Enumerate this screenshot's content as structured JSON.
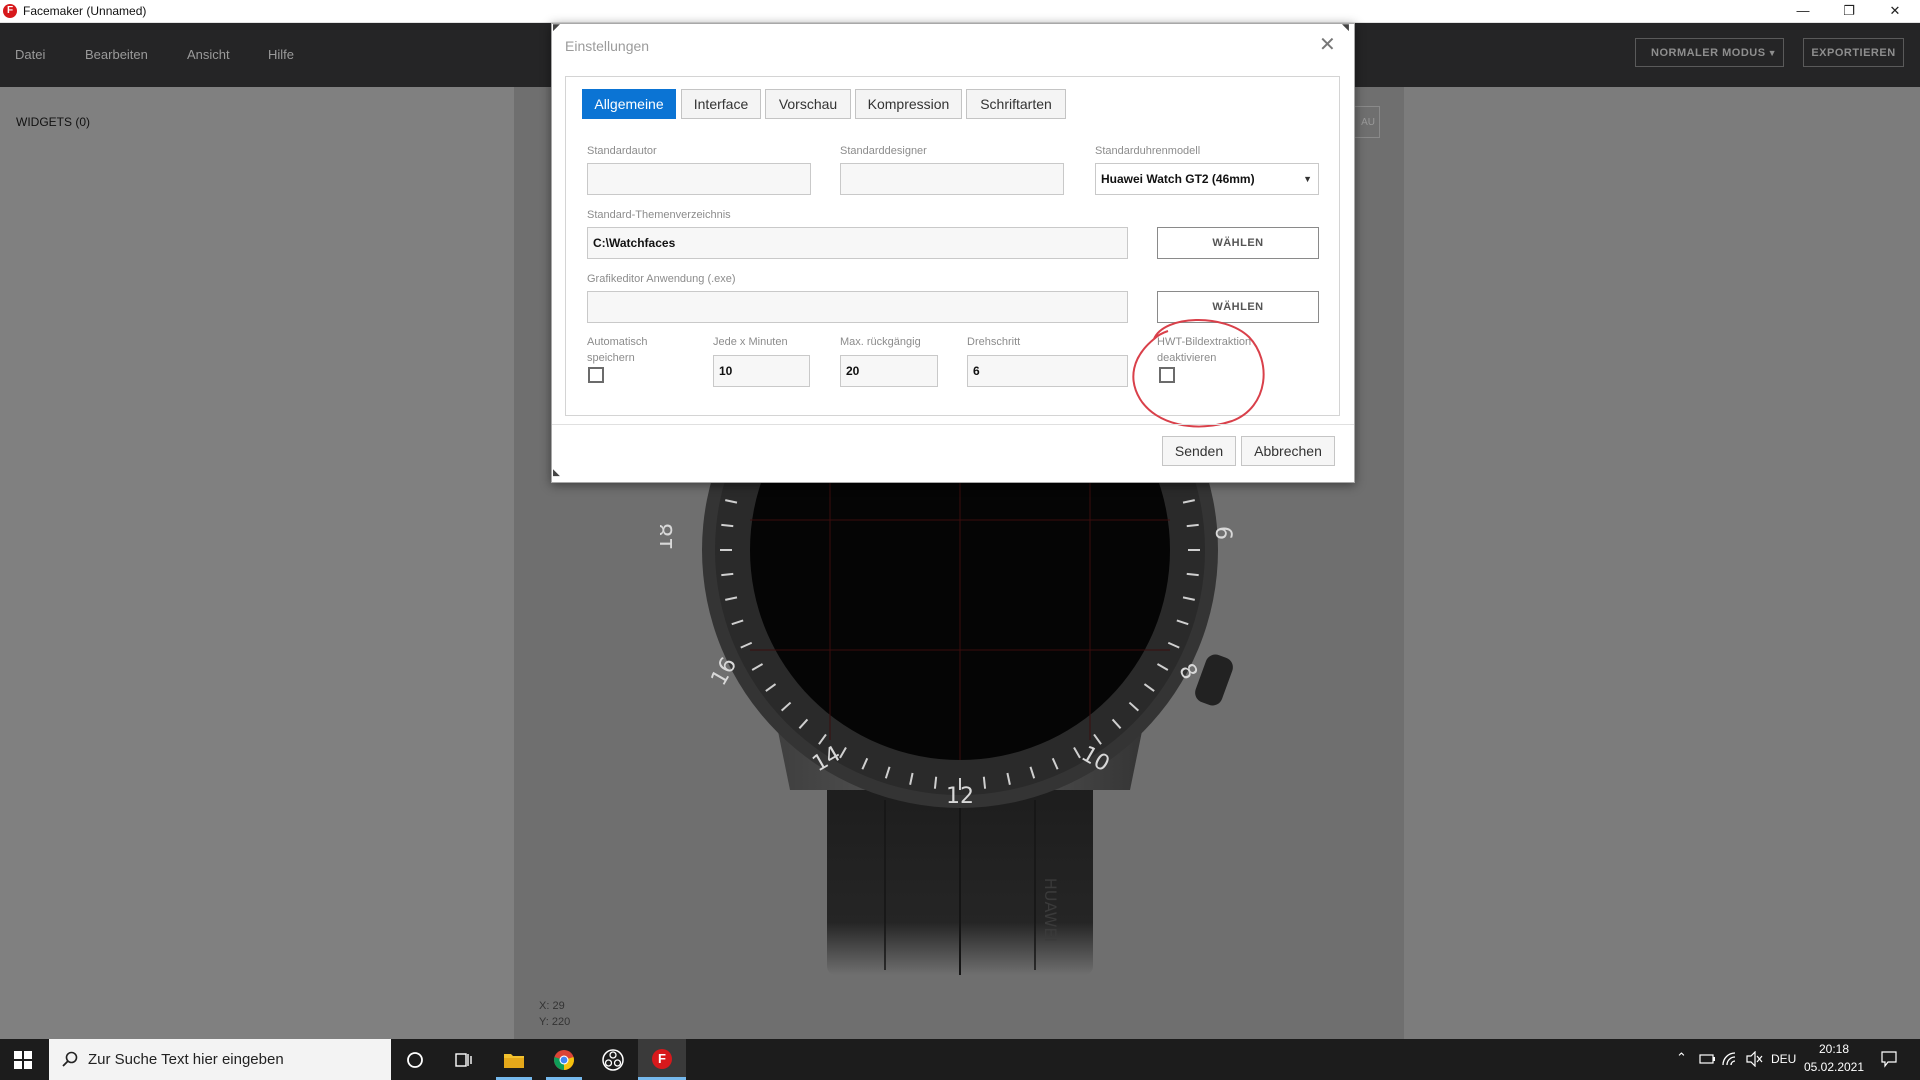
{
  "window": {
    "logo_letter": "F",
    "title": "Facemaker (Unnamed)",
    "controls": {
      "minimize": "—",
      "restore": "❐",
      "close": "✕"
    }
  },
  "menu": {
    "items": [
      "Datei",
      "Bearbeiten",
      "Ansicht",
      "Hilfe"
    ],
    "mode_button": "NORMALER MODUS",
    "export_button": "EXPORTIEREN"
  },
  "left_panel": {
    "widgets_label": "WIDGETS  (0)"
  },
  "canvas": {
    "ghost_button": "AU",
    "cursor": {
      "x_label": "X: 29",
      "y_label": "Y: 220"
    }
  },
  "dialog": {
    "title": "Einstellungen",
    "close_glyph": "✕",
    "tabs": [
      {
        "label": "Allgemeine",
        "active": true
      },
      {
        "label": "Interface",
        "active": false
      },
      {
        "label": "Vorschau",
        "active": false
      },
      {
        "label": "Kompression",
        "active": false
      },
      {
        "label": "Schriftarten",
        "active": false
      }
    ],
    "fields": {
      "standard_author": {
        "label": "Standardautor",
        "value": ""
      },
      "standard_designer": {
        "label": "Standarddesigner",
        "value": ""
      },
      "standard_watch_model": {
        "label": "Standarduhrenmodell",
        "value": "Huawei Watch GT2 (46mm)"
      },
      "theme_directory": {
        "label": "Standard-Themenverzeichnis",
        "value": "C:\\Watchfaces",
        "button": "WÄHLEN"
      },
      "graphics_editor": {
        "label": "Grafikeditor Anwendung (.exe)",
        "value": "",
        "button": "WÄHLEN"
      },
      "autosave": {
        "label_line1": "Automatisch",
        "label_line2": "speichern",
        "checked": false
      },
      "every_x_minutes": {
        "label": "Jede x Minuten",
        "value": "10"
      },
      "max_undo": {
        "label": "Max. rückgängig",
        "value": "20"
      },
      "rotation_step": {
        "label": "Drehschritt",
        "value": "6"
      },
      "hwt_disable": {
        "label_line1": "HWT-Bildextraktion",
        "label_line2": "deaktivieren",
        "checked": false
      }
    },
    "footer": {
      "submit": "Senden",
      "cancel": "Abbrechen"
    }
  },
  "watch": {
    "bezel_numbers": [
      "18",
      "16",
      "14",
      "12",
      "10",
      "8",
      "6"
    ],
    "strap_text": "HUAWEI"
  },
  "taskbar": {
    "search_placeholder": "Zur Suche Text hier eingeben",
    "language": "DEU",
    "time": "20:18",
    "date": "05.02.2021"
  },
  "colors": {
    "accent": "#0b74d4",
    "annotation": "#d9404a",
    "menubar": "#252526",
    "taskbar": "#1c1c1c"
  }
}
